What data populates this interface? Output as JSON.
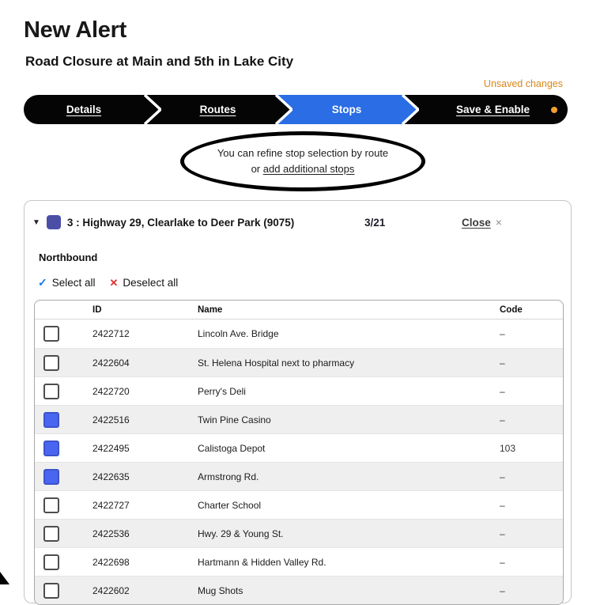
{
  "page": {
    "title": "New Alert",
    "subtitle": "Road Closure at Main and 5th in Lake City",
    "unsaved_changes": "Unsaved changes"
  },
  "stepper": {
    "steps": [
      {
        "label": "Details",
        "active": false
      },
      {
        "label": "Routes",
        "active": false
      },
      {
        "label": "Stops",
        "active": true
      },
      {
        "label": "Save & Enable",
        "active": false
      }
    ]
  },
  "note": {
    "line1": "You can refine stop selection by route",
    "line2_prefix": "or ",
    "link_label": "add additional stops"
  },
  "route_card": {
    "title": "3 : Highway 29, Clearlake to Deer Park (9075)",
    "counter": "3/21",
    "close_label": "Close",
    "close_x": "×",
    "direction": "Northbound",
    "select_all_label": "Select all",
    "deselect_all_label": "Deselect all",
    "select_all_icon": "✓",
    "deselect_all_icon": "✕",
    "caret_icon": "▼"
  },
  "table": {
    "headers": {
      "id": "ID",
      "name": "Name",
      "code": "Code"
    },
    "rows": [
      {
        "id": "2422712",
        "name": "Lincoln Ave. Bridge",
        "code": "–",
        "checked": false
      },
      {
        "id": "2422604",
        "name": "St. Helena Hospital next to pharmacy",
        "code": "–",
        "checked": false
      },
      {
        "id": "2422720",
        "name": "Perry's Deli",
        "code": "–",
        "checked": false
      },
      {
        "id": "2422516",
        "name": "Twin Pine Casino",
        "code": "–",
        "checked": true
      },
      {
        "id": "2422495",
        "name": "Calistoga Depot",
        "code": "103",
        "checked": true
      },
      {
        "id": "2422635",
        "name": "Armstrong Rd.",
        "code": "–",
        "checked": true
      },
      {
        "id": "2422727",
        "name": "Charter School",
        "code": "–",
        "checked": false
      },
      {
        "id": "2422536",
        "name": "Hwy. 29 & Young St.",
        "code": "–",
        "checked": false
      },
      {
        "id": "2422698",
        "name": "Hartmann & Hidden Valley Rd.",
        "code": "–",
        "checked": false
      },
      {
        "id": "2422602",
        "name": "Mug Shots",
        "code": "–",
        "checked": false
      }
    ]
  },
  "colors": {
    "step_active": "#2a6de4",
    "unsaved_text": "#d9861a",
    "notification_dot": "#efa02e",
    "route_swatch": "#4b4fa6",
    "checkbox_checked": "#4a66f0",
    "select_check": "#1a73e8",
    "deselect_x": "#e03131"
  }
}
